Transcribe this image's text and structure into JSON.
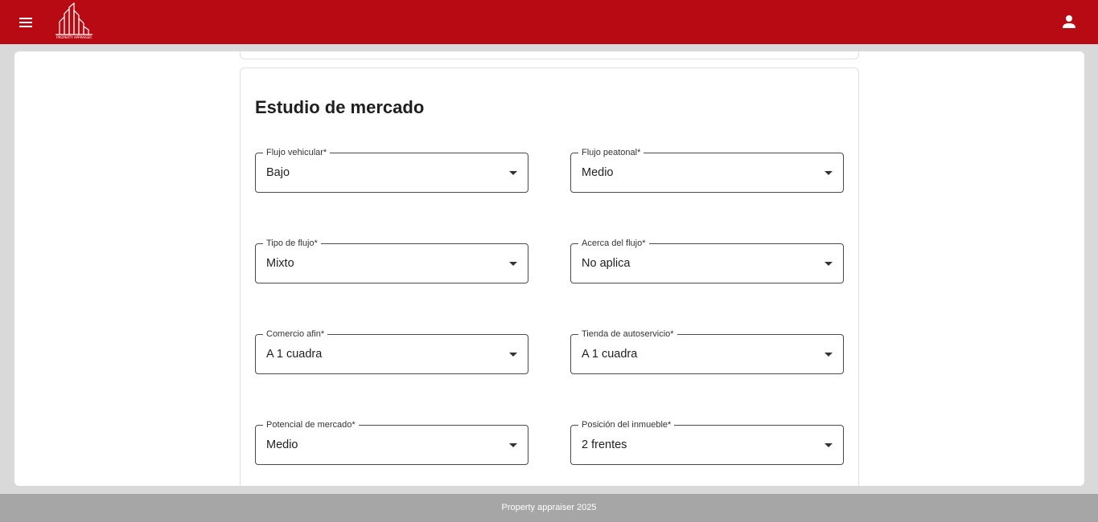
{
  "header": {
    "menu_icon": "menu-icon",
    "logo_text": "PROPERTY APPRAISER",
    "user_icon": "person-icon",
    "colors": {
      "bar": "#b70a13",
      "icon": "#ffffff"
    }
  },
  "market_study": {
    "title": "Estudio de mercado",
    "fields": [
      {
        "label": "Flujo vehicular*",
        "value": "Bajo"
      },
      {
        "label": "Flujo peatonal*",
        "value": "Medio"
      },
      {
        "label": "Tipo de flujo*",
        "value": "Mixto"
      },
      {
        "label": "Acerca del flujo*",
        "value": "No aplica"
      },
      {
        "label": "Comercio afin*",
        "value": "A 1 cuadra"
      },
      {
        "label": "Tienda de autoservicio*",
        "value": "A 1 cuadra"
      },
      {
        "label": "Potencial de mercado*",
        "value": "Medio"
      },
      {
        "label": "Posición del inmueble*",
        "value": "2 frentes"
      }
    ]
  },
  "footer": {
    "text": "Property appraiser 2025"
  }
}
